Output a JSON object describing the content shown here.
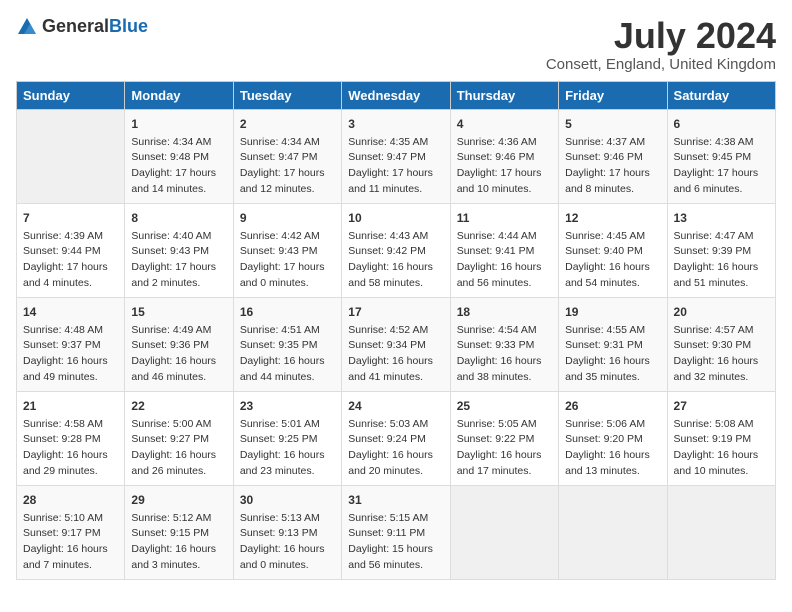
{
  "logo": {
    "general": "General",
    "blue": "Blue"
  },
  "title": "July 2024",
  "location": "Consett, England, United Kingdom",
  "days_of_week": [
    "Sunday",
    "Monday",
    "Tuesday",
    "Wednesday",
    "Thursday",
    "Friday",
    "Saturday"
  ],
  "weeks": [
    [
      {
        "day": "",
        "info": ""
      },
      {
        "day": "1",
        "info": "Sunrise: 4:34 AM\nSunset: 9:48 PM\nDaylight: 17 hours\nand 14 minutes."
      },
      {
        "day": "2",
        "info": "Sunrise: 4:34 AM\nSunset: 9:47 PM\nDaylight: 17 hours\nand 12 minutes."
      },
      {
        "day": "3",
        "info": "Sunrise: 4:35 AM\nSunset: 9:47 PM\nDaylight: 17 hours\nand 11 minutes."
      },
      {
        "day": "4",
        "info": "Sunrise: 4:36 AM\nSunset: 9:46 PM\nDaylight: 17 hours\nand 10 minutes."
      },
      {
        "day": "5",
        "info": "Sunrise: 4:37 AM\nSunset: 9:46 PM\nDaylight: 17 hours\nand 8 minutes."
      },
      {
        "day": "6",
        "info": "Sunrise: 4:38 AM\nSunset: 9:45 PM\nDaylight: 17 hours\nand 6 minutes."
      }
    ],
    [
      {
        "day": "7",
        "info": "Sunrise: 4:39 AM\nSunset: 9:44 PM\nDaylight: 17 hours\nand 4 minutes."
      },
      {
        "day": "8",
        "info": "Sunrise: 4:40 AM\nSunset: 9:43 PM\nDaylight: 17 hours\nand 2 minutes."
      },
      {
        "day": "9",
        "info": "Sunrise: 4:42 AM\nSunset: 9:43 PM\nDaylight: 17 hours\nand 0 minutes."
      },
      {
        "day": "10",
        "info": "Sunrise: 4:43 AM\nSunset: 9:42 PM\nDaylight: 16 hours\nand 58 minutes."
      },
      {
        "day": "11",
        "info": "Sunrise: 4:44 AM\nSunset: 9:41 PM\nDaylight: 16 hours\nand 56 minutes."
      },
      {
        "day": "12",
        "info": "Sunrise: 4:45 AM\nSunset: 9:40 PM\nDaylight: 16 hours\nand 54 minutes."
      },
      {
        "day": "13",
        "info": "Sunrise: 4:47 AM\nSunset: 9:39 PM\nDaylight: 16 hours\nand 51 minutes."
      }
    ],
    [
      {
        "day": "14",
        "info": "Sunrise: 4:48 AM\nSunset: 9:37 PM\nDaylight: 16 hours\nand 49 minutes."
      },
      {
        "day": "15",
        "info": "Sunrise: 4:49 AM\nSunset: 9:36 PM\nDaylight: 16 hours\nand 46 minutes."
      },
      {
        "day": "16",
        "info": "Sunrise: 4:51 AM\nSunset: 9:35 PM\nDaylight: 16 hours\nand 44 minutes."
      },
      {
        "day": "17",
        "info": "Sunrise: 4:52 AM\nSunset: 9:34 PM\nDaylight: 16 hours\nand 41 minutes."
      },
      {
        "day": "18",
        "info": "Sunrise: 4:54 AM\nSunset: 9:33 PM\nDaylight: 16 hours\nand 38 minutes."
      },
      {
        "day": "19",
        "info": "Sunrise: 4:55 AM\nSunset: 9:31 PM\nDaylight: 16 hours\nand 35 minutes."
      },
      {
        "day": "20",
        "info": "Sunrise: 4:57 AM\nSunset: 9:30 PM\nDaylight: 16 hours\nand 32 minutes."
      }
    ],
    [
      {
        "day": "21",
        "info": "Sunrise: 4:58 AM\nSunset: 9:28 PM\nDaylight: 16 hours\nand 29 minutes."
      },
      {
        "day": "22",
        "info": "Sunrise: 5:00 AM\nSunset: 9:27 PM\nDaylight: 16 hours\nand 26 minutes."
      },
      {
        "day": "23",
        "info": "Sunrise: 5:01 AM\nSunset: 9:25 PM\nDaylight: 16 hours\nand 23 minutes."
      },
      {
        "day": "24",
        "info": "Sunrise: 5:03 AM\nSunset: 9:24 PM\nDaylight: 16 hours\nand 20 minutes."
      },
      {
        "day": "25",
        "info": "Sunrise: 5:05 AM\nSunset: 9:22 PM\nDaylight: 16 hours\nand 17 minutes."
      },
      {
        "day": "26",
        "info": "Sunrise: 5:06 AM\nSunset: 9:20 PM\nDaylight: 16 hours\nand 13 minutes."
      },
      {
        "day": "27",
        "info": "Sunrise: 5:08 AM\nSunset: 9:19 PM\nDaylight: 16 hours\nand 10 minutes."
      }
    ],
    [
      {
        "day": "28",
        "info": "Sunrise: 5:10 AM\nSunset: 9:17 PM\nDaylight: 16 hours\nand 7 minutes."
      },
      {
        "day": "29",
        "info": "Sunrise: 5:12 AM\nSunset: 9:15 PM\nDaylight: 16 hours\nand 3 minutes."
      },
      {
        "day": "30",
        "info": "Sunrise: 5:13 AM\nSunset: 9:13 PM\nDaylight: 16 hours\nand 0 minutes."
      },
      {
        "day": "31",
        "info": "Sunrise: 5:15 AM\nSunset: 9:11 PM\nDaylight: 15 hours\nand 56 minutes."
      },
      {
        "day": "",
        "info": ""
      },
      {
        "day": "",
        "info": ""
      },
      {
        "day": "",
        "info": ""
      }
    ]
  ]
}
